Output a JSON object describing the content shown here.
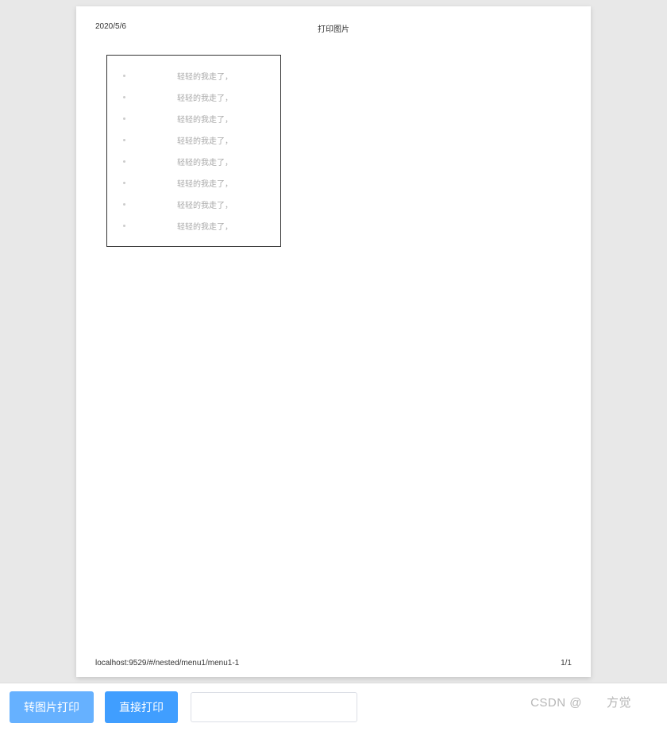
{
  "header": {
    "date": "2020/5/6",
    "title": "打印图片"
  },
  "content": {
    "items": [
      "轻轻的我走了，",
      "轻轻的我走了，",
      "轻轻的我走了，",
      "轻轻的我走了，",
      "轻轻的我走了，",
      "轻轻的我走了，",
      "轻轻的我走了，",
      "轻轻的我走了，"
    ]
  },
  "footer": {
    "url": "localhost:9529/#/nested/menu1/menu1-1",
    "page": "1/1"
  },
  "toolbar": {
    "convert_print_label": "转图片打印",
    "direct_print_label": "直接打印"
  },
  "watermark": "CSDN @　　方觉　　"
}
